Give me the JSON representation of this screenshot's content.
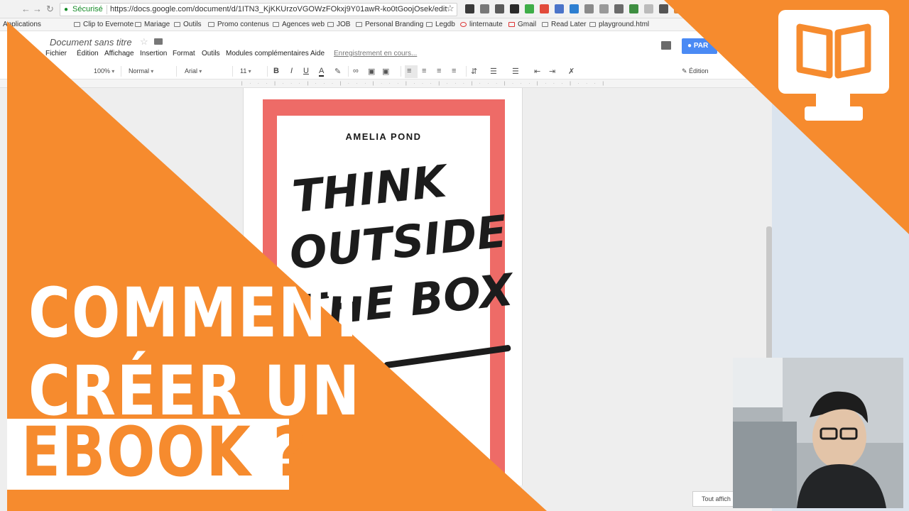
{
  "browser": {
    "secure_label": "Sécurisé",
    "url": "https://docs.google.com/document/d/1ITN3_KjKKUrzoVGOWzFOkxj9Y01awR-ko0tGoojOsek/edit",
    "bookmarks": [
      "Applications",
      "Clip to Evernote",
      "Mariage",
      "Outils",
      "Promo contenus",
      "Agences web",
      "JOB",
      "Personal Branding",
      "Legdb",
      "linternaute",
      "Gmail",
      "Read Later",
      "playground.html"
    ]
  },
  "docs": {
    "title": "Document sans titre",
    "menu": [
      "Fichier",
      "Édition",
      "Affichage",
      "Insertion",
      "Format",
      "Outils",
      "Modules complémentaires",
      "Aide"
    ],
    "save_status": "Enregistrement en cours...",
    "share_label": "PAR",
    "toolbar": {
      "zoom": "100%",
      "style": "Normal",
      "font": "Arial",
      "size": "11",
      "bold": "B",
      "italic": "I",
      "underline": "U",
      "text_color": "A",
      "mode": "Édition"
    },
    "show_all": "Tout affich"
  },
  "cover": {
    "author": "AMELIA POND",
    "line1": "THINK",
    "line2": "OUTSIDE",
    "line3": "THE BOX"
  },
  "headline": {
    "line1": "COMMENT",
    "line2": "CRÉER UN",
    "line3": "EBOOK ?"
  },
  "colors": {
    "orange": "#f68b2e",
    "cover_red": "#ee6b67",
    "share_blue": "#4a8af4"
  }
}
